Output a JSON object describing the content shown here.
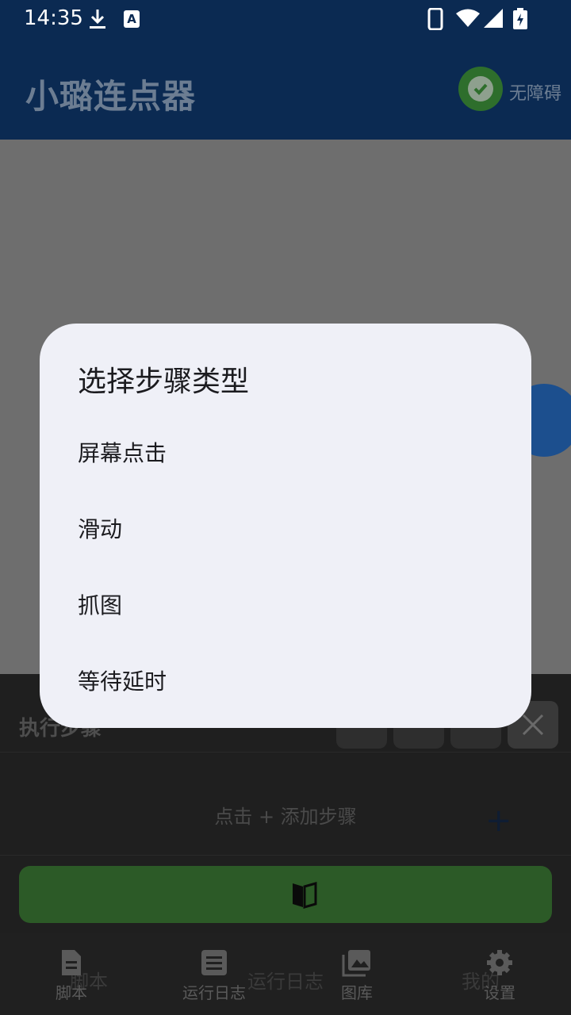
{
  "status_bar": {
    "time": "14:35"
  },
  "app_bar": {
    "title": "小璐连点器",
    "accessibility_label": "无障碍"
  },
  "panel": {
    "title": "执行步骤",
    "hint": "点击 + 添加步骤",
    "add_symbol": "+"
  },
  "bottom_nav": {
    "items": [
      {
        "label": "脚本",
        "icon": "script-doc-icon"
      },
      {
        "label": "运行日志",
        "icon": "log-list-icon"
      },
      {
        "label": "图库",
        "icon": "gallery-icon"
      },
      {
        "label": "设置",
        "icon": "gear-icon"
      }
    ],
    "ghost_labels": {
      "script": "脚本",
      "log": "运行日志",
      "mine": "我的"
    }
  },
  "dialog": {
    "title": "选择步骤类型",
    "options": [
      "屏幕点击",
      "滑动",
      "抓图",
      "等待延时"
    ]
  },
  "colors": {
    "app_bar": "#0b2a52",
    "dialog_bg": "#eff0f7",
    "run_button": "#2c5a27",
    "scrim": "#6e6e6e"
  }
}
